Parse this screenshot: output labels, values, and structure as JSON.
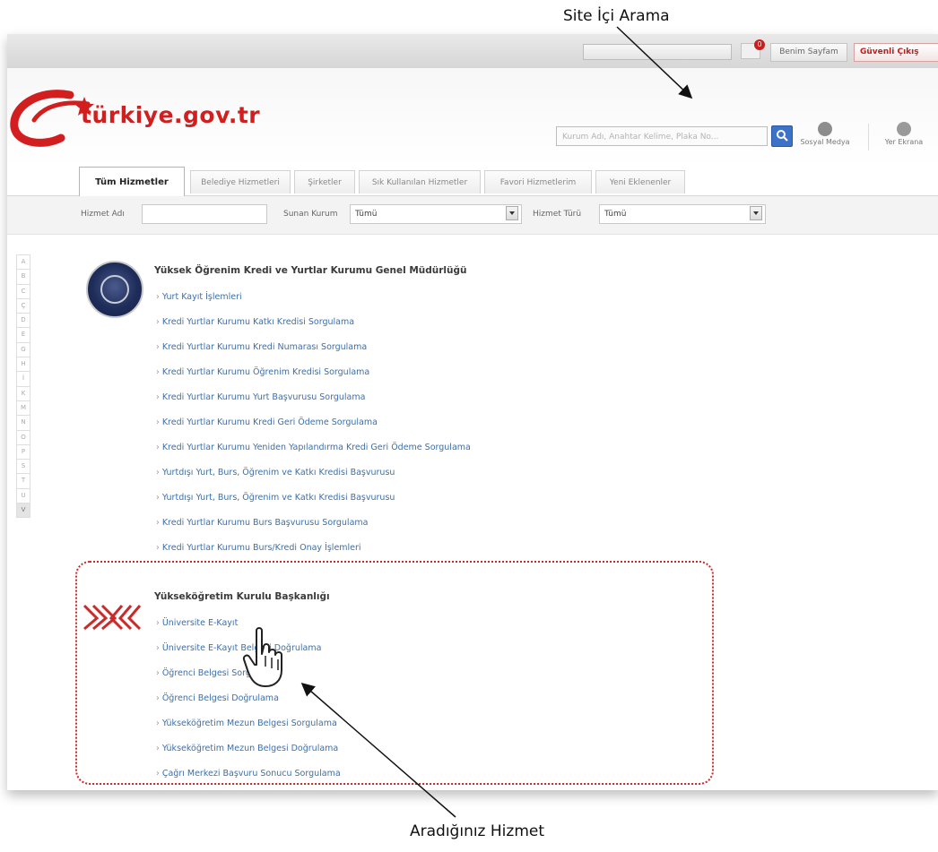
{
  "annotations": {
    "search_label": "Site İçi Arama",
    "service_label": "Aradığınız Hizmet"
  },
  "topbar": {
    "input_placeholder": "",
    "mail_badge": "0",
    "my_pages": "Benim Sayfam",
    "logout": "Güvenli Çıkış"
  },
  "header": {
    "logo_text": "türkiye.gov.tr",
    "search_placeholder": "Kurum Adı, Anahtar Kelime, Plaka No...",
    "social": "Sosyal Medya",
    "other": "Yer Ekrana"
  },
  "tabs": [
    {
      "label": "Tüm Hizmetler",
      "active": true
    },
    {
      "label": "Belediye Hizmetleri",
      "active": false
    },
    {
      "label": "Şirketler",
      "active": false
    },
    {
      "label": "Sık Kullanılan Hizmetler",
      "active": false
    },
    {
      "label": "Favori Hizmetlerim",
      "active": false
    },
    {
      "label": "Yeni Eklenenler",
      "active": false
    }
  ],
  "filters": {
    "service_name_label": "Hizmet Adı",
    "service_name_value": "",
    "institution_label": "Sunan Kurum",
    "institution_value": "Tümü",
    "type_label": "Hizmet Türü",
    "type_value": "Tümü"
  },
  "alphabet": [
    "A",
    "B",
    "C",
    "Ç",
    "D",
    "E",
    "G",
    "H",
    "İ",
    "K",
    "M",
    "N",
    "O",
    "P",
    "S",
    "T",
    "U",
    "V"
  ],
  "orgs": [
    {
      "title": "Yüksek Öğrenim Kredi ve Yurtlar Kurumu Genel Müdürlüğü",
      "services": [
        "Yurt Kayıt İşlemleri",
        "Kredi Yurtlar Kurumu Katkı Kredisi Sorgulama",
        "Kredi Yurtlar Kurumu Kredi Numarası Sorgulama",
        "Kredi Yurtlar Kurumu Öğrenim Kredisi Sorgulama",
        "Kredi Yurtlar Kurumu Yurt Başvurusu Sorgulama",
        "Kredi Yurtlar Kurumu Kredi Geri Ödeme Sorgulama",
        "Kredi Yurtlar Kurumu Yeniden Yapılandırma Kredi Geri Ödeme Sorgulama",
        "Yurtdışı Yurt, Burs, Öğrenim ve Katkı Kredisi Başvurusu",
        "Yurtdışı Yurt, Burs, Öğrenim ve Katkı Kredisi Başvurusu",
        "Kredi Yurtlar Kurumu Burs Başvurusu Sorgulama",
        "Kredi Yurtlar Kurumu Burs/Kredi Onay İşlemleri"
      ]
    },
    {
      "title": "Yükseköğretim Kurulu Başkanlığı",
      "services": [
        "Üniversite E-Kayıt",
        "Üniversite E-Kayıt Belgesi Doğrulama",
        "Öğrenci Belgesi Sorgulama",
        "Öğrenci Belgesi Doğrulama",
        "Yükseköğretim Mezun Belgesi Sorgulama",
        "Yükseköğretim Mezun Belgesi Doğrulama",
        "Çağrı Merkezi Başvuru Sonucu Sorgulama"
      ]
    }
  ],
  "colors": {
    "brand_red": "#d21e1e",
    "link_blue": "#3a6fae",
    "highlight_border": "#c92a2a"
  }
}
